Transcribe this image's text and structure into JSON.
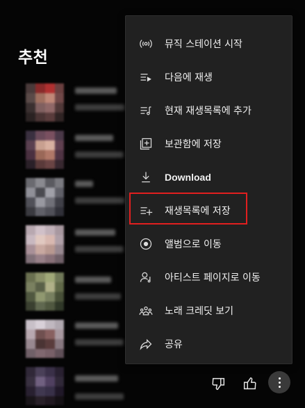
{
  "section": {
    "title": "추천"
  },
  "menu": {
    "items": [
      {
        "label": "뮤직 스테이션 시작",
        "icon": "radio-icon"
      },
      {
        "label": "다음에 재생",
        "icon": "play-next-icon"
      },
      {
        "label": "현재 재생목록에 추가",
        "icon": "add-to-queue-icon"
      },
      {
        "label": "보관함에 저장",
        "icon": "library-add-icon"
      },
      {
        "label": "Download",
        "icon": "download-icon"
      },
      {
        "label": "재생목록에 저장",
        "icon": "playlist-add-icon"
      },
      {
        "label": "앨범으로 이동",
        "icon": "album-icon"
      },
      {
        "label": "아티스트 페이지로 이동",
        "icon": "artist-icon"
      },
      {
        "label": "노래 크레딧 보기",
        "icon": "credits-icon"
      },
      {
        "label": "공유",
        "icon": "share-icon"
      }
    ]
  },
  "colors": {
    "background": "#050505",
    "menu_bg": "#212121",
    "highlight": "#e21f1f",
    "text": "#f1f1f1"
  }
}
